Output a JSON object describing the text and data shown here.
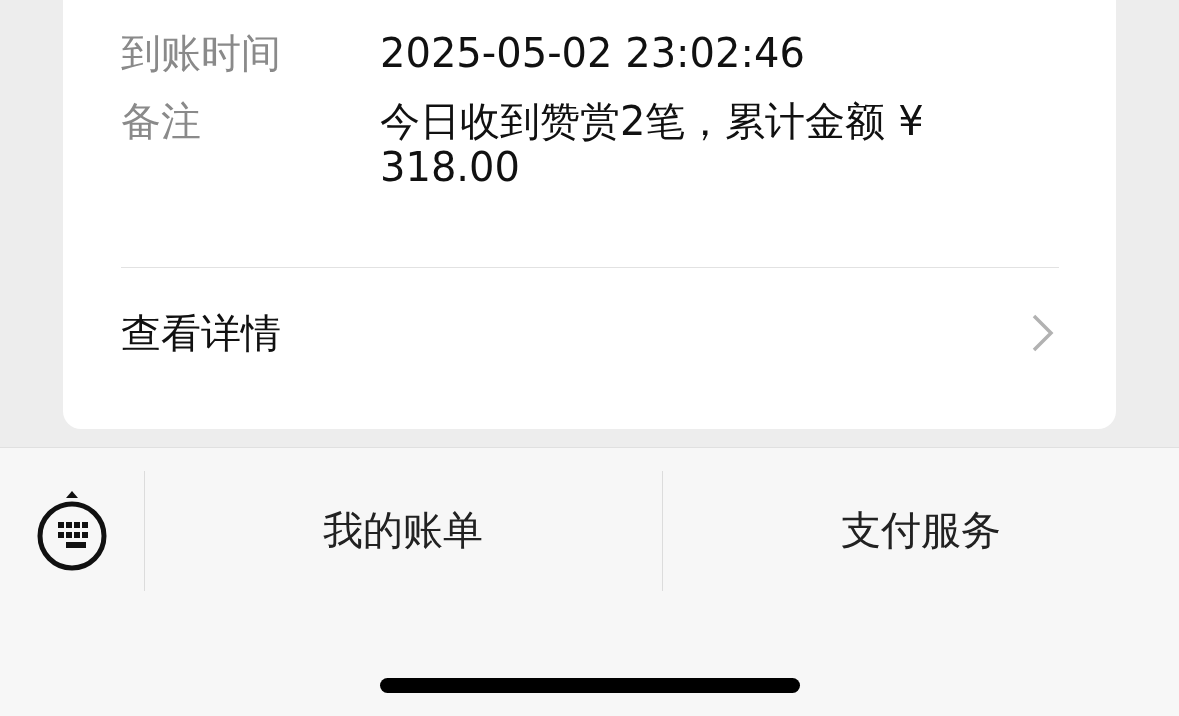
{
  "details": [
    {
      "label": "到账时间",
      "value": "2025-05-02 23:02:46"
    },
    {
      "label": "备注",
      "value": "今日收到赞赏2笔，累计金额 ¥ 318.00"
    }
  ],
  "link": {
    "label": "查看详情"
  },
  "bottom_bar": {
    "buttons": [
      {
        "label": "我的账单"
      },
      {
        "label": "支付服务"
      }
    ]
  }
}
